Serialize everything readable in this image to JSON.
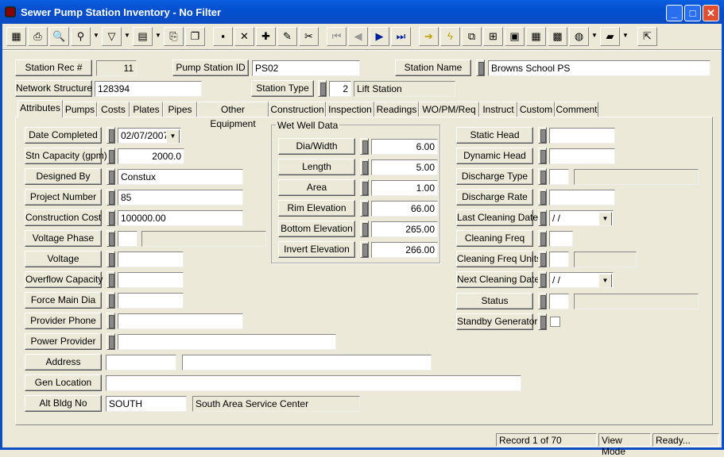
{
  "window": {
    "title": "Sewer Pump Station Inventory - No Filter",
    "minimize": "_",
    "maximize": "□",
    "close": "✕"
  },
  "toolbar": [
    "grid-icon",
    "print-icon",
    "preview-icon",
    "find-icon",
    "filter-icon",
    "report-icon",
    "export-icon",
    "copy-icon",
    "save-icon",
    "delete-icon",
    "add-record-icon",
    "edit-icon",
    "cut-icon",
    "first-icon",
    "prev-icon",
    "next-icon",
    "last-icon",
    "goto-icon",
    "lightning-icon",
    "workflow-icon",
    "diagram-icon",
    "image-icon",
    "calendar-icon",
    "map-icon",
    "globe-icon",
    "help-book-icon",
    "exit-icon"
  ],
  "header": {
    "station_rec_label": "Station Rec #",
    "station_rec_value": "11",
    "pump_station_id_label": "Pump Station ID",
    "pump_station_id_value": "PS02",
    "station_name_label": "Station Name",
    "station_name_value": "Browns School PS",
    "network_structure_label": "Network Structure",
    "network_structure_value": "128394",
    "station_type_label": "Station Type",
    "station_type_code": "2",
    "station_type_desc": "Lift Station"
  },
  "tabs": [
    "Attributes",
    "Pumps",
    "Costs",
    "Plates",
    "Pipes",
    "Other Equipment",
    "Construction",
    "Inspection",
    "Readings",
    "WO/PM/Req",
    "Instruct",
    "Custom",
    "Comment"
  ],
  "active_tab": "Attributes",
  "left_fields": [
    {
      "label": "Date Completed",
      "value": "02/07/2007"
    },
    {
      "label": "Stn Capacity (gpm)",
      "value": "2000.0"
    },
    {
      "label": "Designed By",
      "value": "Constux"
    },
    {
      "label": "Project Number",
      "value": "85"
    },
    {
      "label": "Construction Cost",
      "value": "100000.00"
    },
    {
      "label": "Voltage Phase",
      "value": "",
      "extra": ""
    },
    {
      "label": "Voltage",
      "value": ""
    },
    {
      "label": "Overflow Capacity",
      "value": ""
    },
    {
      "label": "Force Main Dia",
      "value": ""
    },
    {
      "label": "Provider Phone",
      "value": ""
    },
    {
      "label": "Power Provider",
      "value": ""
    },
    {
      "label": "Address",
      "value": "",
      "extra": ""
    },
    {
      "label": "Gen Location",
      "value": ""
    },
    {
      "label": "Alt Bldg No",
      "value": "SOUTH",
      "extra": "South Area Service Center"
    }
  ],
  "wet_well": {
    "title": "Wet Well Data",
    "fields": [
      {
        "label": "Dia/Width",
        "value": "6.00"
      },
      {
        "label": "Length",
        "value": "5.00"
      },
      {
        "label": "Area",
        "value": "1.00"
      },
      {
        "label": "Rim Elevation",
        "value": "66.00"
      },
      {
        "label": "Bottom Elevation",
        "value": "265.00"
      },
      {
        "label": "Invert Elevation",
        "value": "266.00"
      }
    ]
  },
  "right_fields": [
    {
      "label": "Static Head",
      "value": ""
    },
    {
      "label": "Dynamic Head",
      "value": ""
    },
    {
      "label": "Discharge Type",
      "value": "",
      "extra": ""
    },
    {
      "label": "Discharge Rate",
      "value": ""
    },
    {
      "label": "Last Cleaning Date",
      "value": " / /"
    },
    {
      "label": "Cleaning Freq",
      "value": ""
    },
    {
      "label": "Cleaning Freq Units",
      "value": "",
      "extra": ""
    },
    {
      "label": "Next Cleaning Date",
      "value": " / /"
    },
    {
      "label": "Status",
      "value": "",
      "extra": ""
    },
    {
      "label": "Standby Generator",
      "checked": false
    }
  ],
  "status": {
    "record": "Record 1 of 70",
    "mode": "View Mode",
    "state": "Ready..."
  }
}
